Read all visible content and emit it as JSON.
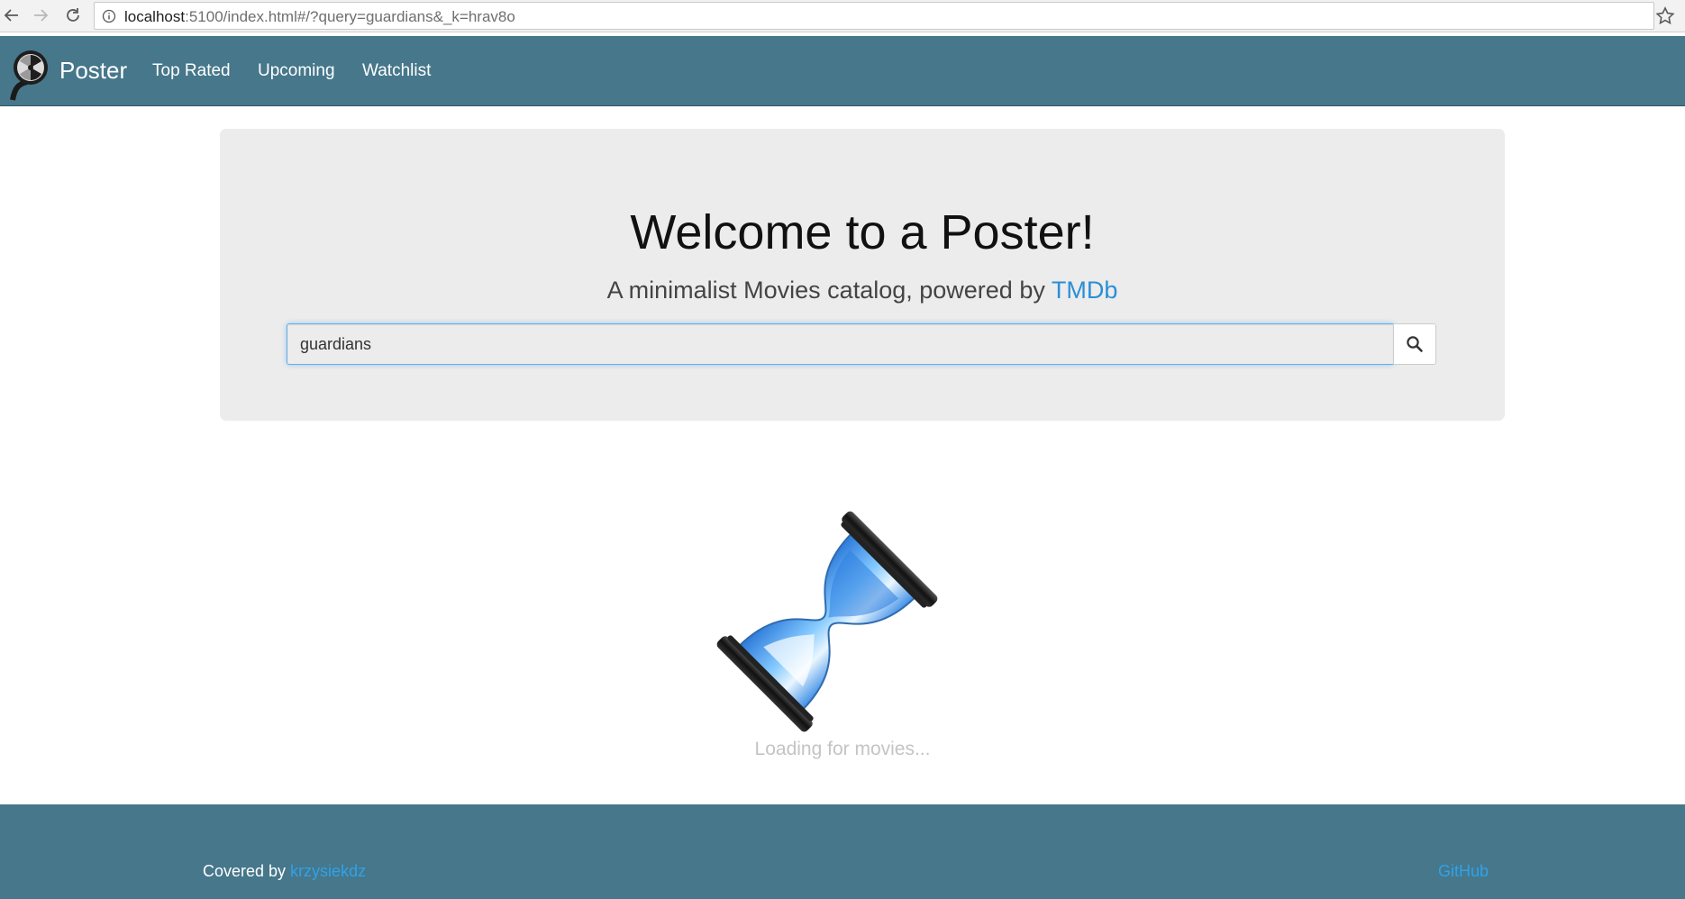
{
  "browser": {
    "url_host": "localhost",
    "url_rest": ":5100/index.html#/?query=guardians&_k=hrav8o"
  },
  "navbar": {
    "brand": "Poster",
    "links": [
      "Top Rated",
      "Upcoming",
      "Watchlist"
    ]
  },
  "hero": {
    "title": "Welcome to a Poster!",
    "subtitle_prefix": "A minimalist Movies catalog, powered by ",
    "subtitle_link": "TMDb"
  },
  "search": {
    "value": "guardians"
  },
  "loader": {
    "text": "Loading for movies..."
  },
  "footer": {
    "covered_prefix": "Covered by ",
    "author": "krzysiekdz",
    "github": "GitHub"
  },
  "colors": {
    "navbar": "#46778b",
    "link": "#2a8fd6",
    "jumbotron": "#ececec"
  }
}
